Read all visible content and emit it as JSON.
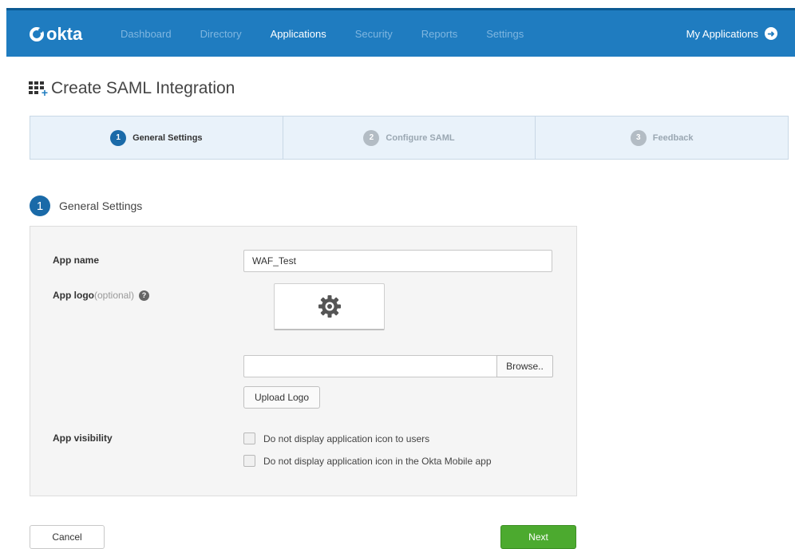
{
  "nav": {
    "logo": "okta",
    "items": [
      {
        "label": "Dashboard",
        "active": false
      },
      {
        "label": "Directory",
        "active": false
      },
      {
        "label": "Applications",
        "active": true
      },
      {
        "label": "Security",
        "active": false
      },
      {
        "label": "Reports",
        "active": false
      },
      {
        "label": "Settings",
        "active": false
      }
    ],
    "my_apps": "My Applications",
    "brand_color": "#1f7cc0"
  },
  "page": {
    "title": "Create SAML Integration",
    "title_icon": "apps-grid-add-icon"
  },
  "wizard": {
    "steps": [
      {
        "num": "1",
        "label": "General Settings",
        "active": true
      },
      {
        "num": "2",
        "label": "Configure SAML",
        "active": false
      },
      {
        "num": "3",
        "label": "Feedback",
        "active": false
      }
    ]
  },
  "section": {
    "num": "1",
    "title": "General Settings"
  },
  "form": {
    "app_name_label": "App name",
    "app_name_value": "WAF_Test",
    "app_logo_label": "App logo",
    "app_logo_optional": "(optional)",
    "help_icon": "?",
    "logo_placeholder_icon": "gear-icon",
    "file_value": "",
    "browse_label": "Browse..",
    "upload_label": "Upload Logo",
    "visibility_label": "App visibility",
    "visibility_options": [
      {
        "label": "Do not display application icon to users",
        "checked": false
      },
      {
        "label": "Do not display application icon in the Okta Mobile app",
        "checked": false
      }
    ]
  },
  "actions": {
    "cancel": "Cancel",
    "next": "Next",
    "next_color": "#4caa2f"
  }
}
